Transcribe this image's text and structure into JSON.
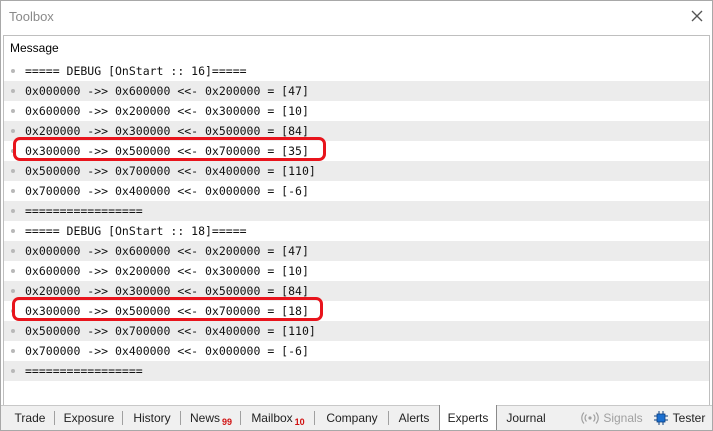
{
  "window": {
    "title": "Toolbox"
  },
  "panel": {
    "column_header": "Message"
  },
  "log": [
    "===== DEBUG [OnStart :: 16]=====",
    "0x000000 ->> 0x600000 <<- 0x200000 = [47]",
    "0x600000 ->> 0x200000 <<- 0x300000 = [10]",
    "0x200000 ->> 0x300000 <<- 0x500000 = [84]",
    "0x300000 ->> 0x500000 <<- 0x700000 = [35]",
    "0x500000 ->> 0x700000 <<- 0x400000 = [110]",
    "0x700000 ->> 0x400000 <<- 0x000000 = [-6]",
    "=================",
    "===== DEBUG [OnStart :: 18]=====",
    "0x000000 ->> 0x600000 <<- 0x200000 = [47]",
    "0x600000 ->> 0x200000 <<- 0x300000 = [10]",
    "0x200000 ->> 0x300000 <<- 0x500000 = [84]",
    "0x300000 ->> 0x500000 <<- 0x700000 = [18]",
    "0x500000 ->> 0x700000 <<- 0x400000 = [110]",
    "0x700000 ->> 0x400000 <<- 0x000000 = [-6]",
    "================="
  ],
  "highlight_color": "#e8141c",
  "tabs": {
    "trade": "Trade",
    "exposure": "Exposure",
    "history": "History",
    "news": "News",
    "news_badge": "99",
    "mailbox": "Mailbox",
    "mailbox_badge": "10",
    "company": "Company",
    "alerts": "Alerts",
    "experts": "Experts",
    "journal": "Journal",
    "signals": "Signals",
    "tester": "Tester",
    "active": "experts"
  }
}
